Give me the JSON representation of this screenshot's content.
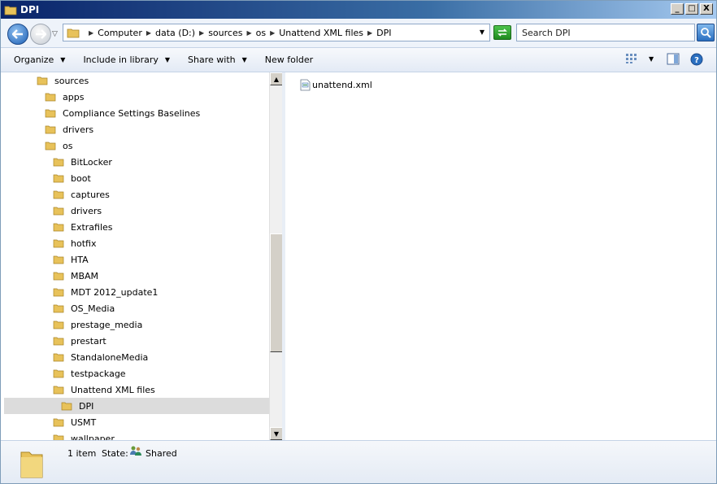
{
  "window": {
    "title": "DPI",
    "minimize": "_",
    "maximize": "□",
    "close": "X"
  },
  "address": {
    "crumbs": [
      "Computer",
      "data (D:)",
      "sources",
      "os",
      "Unattend XML files",
      "DPI"
    ],
    "search_placeholder": "Search DPI"
  },
  "toolbar": {
    "organize": "Organize",
    "include_in_library": "Include in library",
    "share_with": "Share with",
    "new_folder": "New folder"
  },
  "tree": [
    {
      "label": "sources",
      "level": 0
    },
    {
      "label": "apps",
      "level": 1
    },
    {
      "label": "Compliance Settings Baselines",
      "level": 1
    },
    {
      "label": "drivers",
      "level": 1
    },
    {
      "label": "os",
      "level": 1
    },
    {
      "label": "BitLocker",
      "level": 2
    },
    {
      "label": "boot",
      "level": 2
    },
    {
      "label": "captures",
      "level": 2
    },
    {
      "label": "drivers",
      "level": 2
    },
    {
      "label": "Extrafiles",
      "level": 2
    },
    {
      "label": "hotfix",
      "level": 2
    },
    {
      "label": "HTA",
      "level": 2
    },
    {
      "label": "MBAM",
      "level": 2
    },
    {
      "label": "MDT 2012_update1",
      "level": 2
    },
    {
      "label": "OS_Media",
      "level": 2
    },
    {
      "label": "prestage_media",
      "level": 2
    },
    {
      "label": "prestart",
      "level": 2
    },
    {
      "label": "StandaloneMedia",
      "level": 2
    },
    {
      "label": "testpackage",
      "level": 2
    },
    {
      "label": "Unattend XML files",
      "level": 2
    },
    {
      "label": "DPI",
      "level": 3,
      "selected": true
    },
    {
      "label": "USMT",
      "level": 2
    },
    {
      "label": "wallpaper",
      "level": 2
    }
  ],
  "files": [
    {
      "name": "unattend.xml",
      "icon": "xml-file-icon"
    }
  ],
  "details": {
    "item_count": "1 item",
    "state_label": "State:",
    "state_value": "Shared"
  },
  "colors": {
    "folder": "#e8c25a",
    "selection": "#dcdcdc",
    "accent": "#1c5fb5"
  }
}
